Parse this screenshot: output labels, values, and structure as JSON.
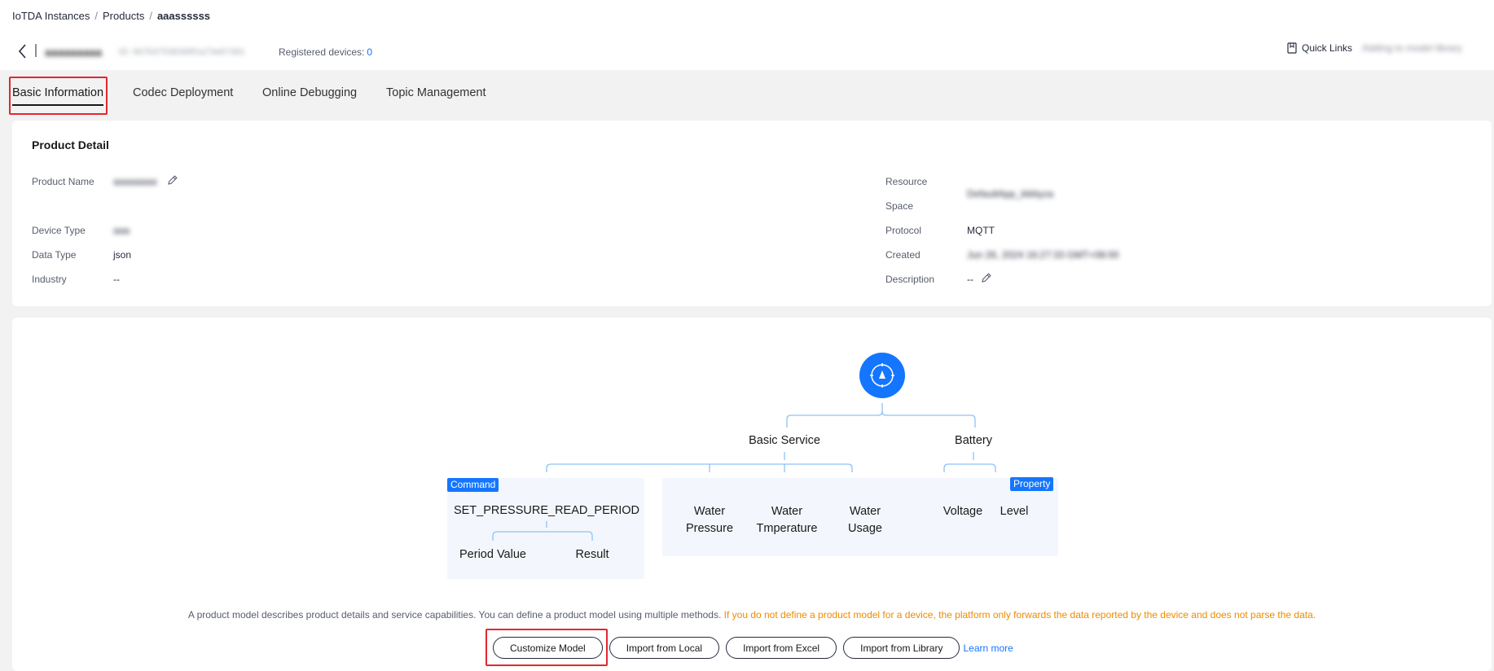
{
  "breadcrumb": {
    "items": [
      "IoTDA Instances",
      "Products",
      "aaassssss"
    ],
    "separator": "/"
  },
  "header": {
    "product_name": "aaaaaaaaa",
    "product_id": "ID: 667b37538368f1a73e67381",
    "registered_label": "Registered devices:",
    "registered_count": "0",
    "quick_links": "Quick Links",
    "add_library": "Adding to model library"
  },
  "tabs": [
    {
      "label": "Basic Information",
      "active": true
    },
    {
      "label": "Codec Deployment",
      "active": false
    },
    {
      "label": "Online Debugging",
      "active": false
    },
    {
      "label": "Topic Management",
      "active": false
    }
  ],
  "product_detail": {
    "title": "Product Detail",
    "fields": {
      "product_name": {
        "label": "Product Name",
        "value": "aaaaaaaa"
      },
      "device_type": {
        "label": "Device Type",
        "value": "aaa"
      },
      "data_type": {
        "label": "Data Type",
        "value": "json"
      },
      "industry": {
        "label": "Industry",
        "value": "--"
      },
      "resource_space": {
        "label_line1": "Resource",
        "label_line2": "Space",
        "value": "DefaultApp_iiiiiiiiyza"
      },
      "protocol": {
        "label": "Protocol",
        "value": "MQTT"
      },
      "created": {
        "label": "Created",
        "value": "Jun 26, 2024 16:27:33 GMT+08:00"
      },
      "description": {
        "label": "Description",
        "value": "--"
      }
    }
  },
  "model_diagram": {
    "services": [
      {
        "name": "Basic Service",
        "command_tag": "Command",
        "command": {
          "name": "SET_PRESSURE_READ_PERIOD",
          "params": [
            "Period Value",
            "Result"
          ]
        },
        "properties": [
          {
            "line1": "Water",
            "line2": "Pressure"
          },
          {
            "line1": "Water",
            "line2": "Tmperature"
          },
          {
            "line1": "Water",
            "line2": "Usage"
          }
        ]
      },
      {
        "name": "Battery",
        "property_tag": "Property",
        "properties": [
          {
            "line1": "Voltage"
          },
          {
            "line1": "Level"
          }
        ]
      }
    ]
  },
  "model_description": {
    "normal": "A product model describes product details and service capabilities. You can define a product model using multiple methods.",
    "warning": "If you do not define a product model for a device, the platform only forwards the data reported by the device and does not parse the data."
  },
  "actions": {
    "customize": "Customize Model",
    "import_local": "Import from Local",
    "import_excel": "Import from Excel",
    "import_library": "Import from Library",
    "learn_more": "Learn more"
  },
  "colors": {
    "accent": "#1476ff",
    "warning": "#ed8b00",
    "highlight": "#e0282e",
    "line": "#8ec2f5"
  }
}
